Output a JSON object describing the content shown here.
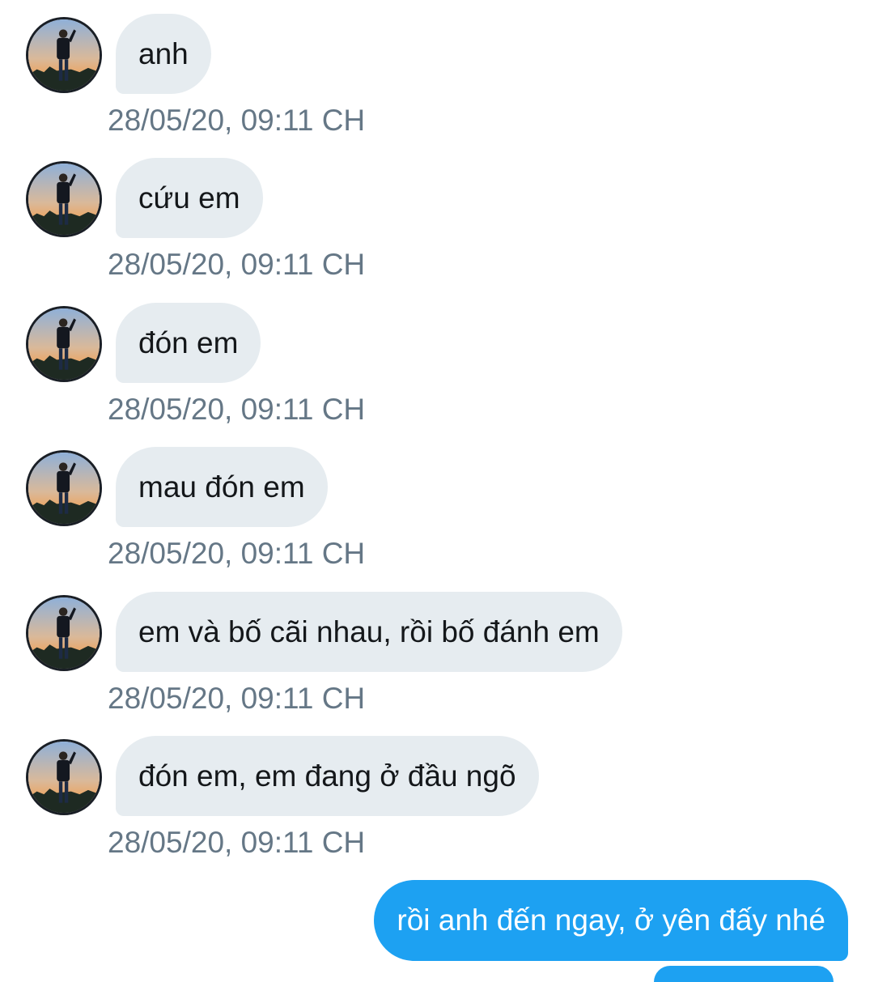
{
  "conversation": {
    "incoming": [
      {
        "text": "anh",
        "timestamp": "28/05/20, 09:11 CH"
      },
      {
        "text": "cứu em",
        "timestamp": "28/05/20, 09:11 CH"
      },
      {
        "text": "đón em",
        "timestamp": "28/05/20, 09:11 CH"
      },
      {
        "text": "mau đón em",
        "timestamp": "28/05/20, 09:11 CH"
      },
      {
        "text": "em và bố cãi nhau, rồi bố đánh em",
        "timestamp": "28/05/20, 09:11 CH"
      },
      {
        "text": "đón em, em đang ở đầu ngõ",
        "timestamp": "28/05/20, 09:11 CH"
      }
    ],
    "outgoing": [
      {
        "text": "rồi anh đến ngay, ở yên đấy nhé"
      }
    ]
  },
  "colors": {
    "incoming_bubble": "#e6ecf0",
    "outgoing_bubble": "#1da1f2",
    "timestamp_text": "#657786",
    "message_text": "#14171a"
  },
  "icons": {
    "avatar": "profile-photo-avatar"
  }
}
